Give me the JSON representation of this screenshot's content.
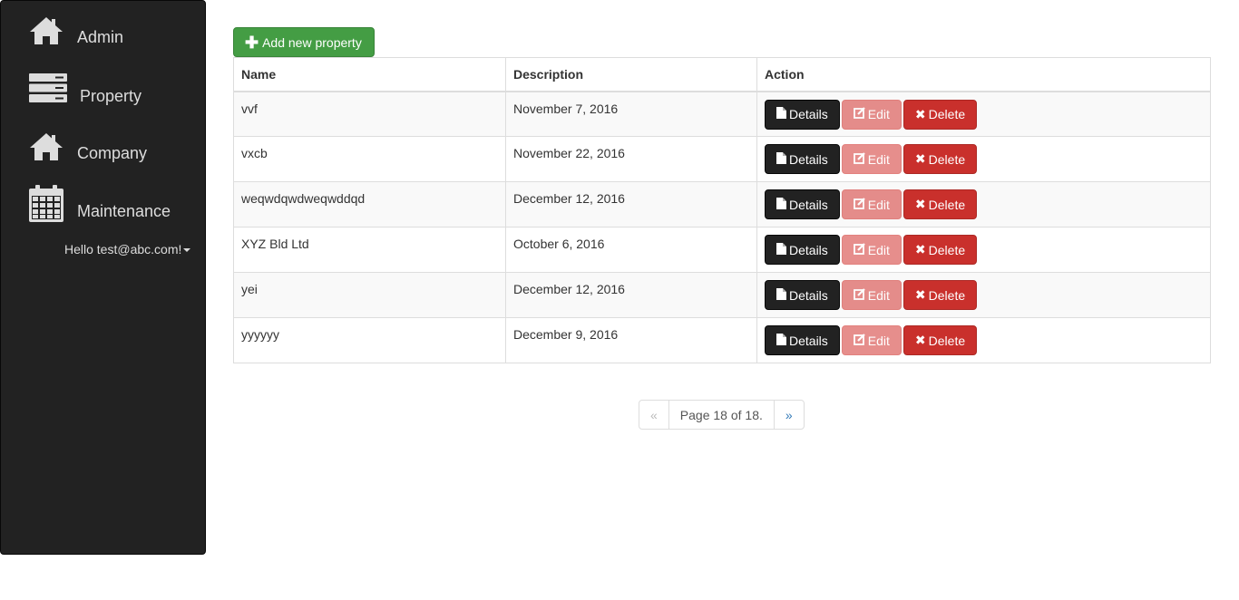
{
  "sidebar": {
    "items": [
      {
        "label": "Admin",
        "icon": "home-icon"
      },
      {
        "label": "Property",
        "icon": "server-icon"
      },
      {
        "label": "Company",
        "icon": "home-icon"
      },
      {
        "label": "Maintenance",
        "icon": "calendar-icon"
      }
    ],
    "user_greeting": "Hello test@abc.com!"
  },
  "toolbar": {
    "add_label": "Add new property"
  },
  "table": {
    "columns": [
      "Name",
      "Description",
      "Action"
    ],
    "rows": [
      {
        "name": "vvf",
        "description": "November 7, 2016"
      },
      {
        "name": "vxcb",
        "description": "November 22, 2016"
      },
      {
        "name": "weqwdqwdweqwddqd",
        "description": "December 12, 2016"
      },
      {
        "name": "XYZ Bld Ltd",
        "description": "October 6, 2016"
      },
      {
        "name": "yei",
        "description": "December 12, 2016"
      },
      {
        "name": "yyyyyy",
        "description": "December 9, 2016"
      }
    ],
    "actions": {
      "details": "Details",
      "edit": "Edit",
      "delete": "Delete"
    }
  },
  "pager": {
    "prev": "«",
    "info": "Page 18 of 18.",
    "next": "»"
  },
  "colors": {
    "sidebar_bg": "#222222",
    "success": "#449d44",
    "danger": "#c9302c",
    "link": "#337ab7"
  }
}
